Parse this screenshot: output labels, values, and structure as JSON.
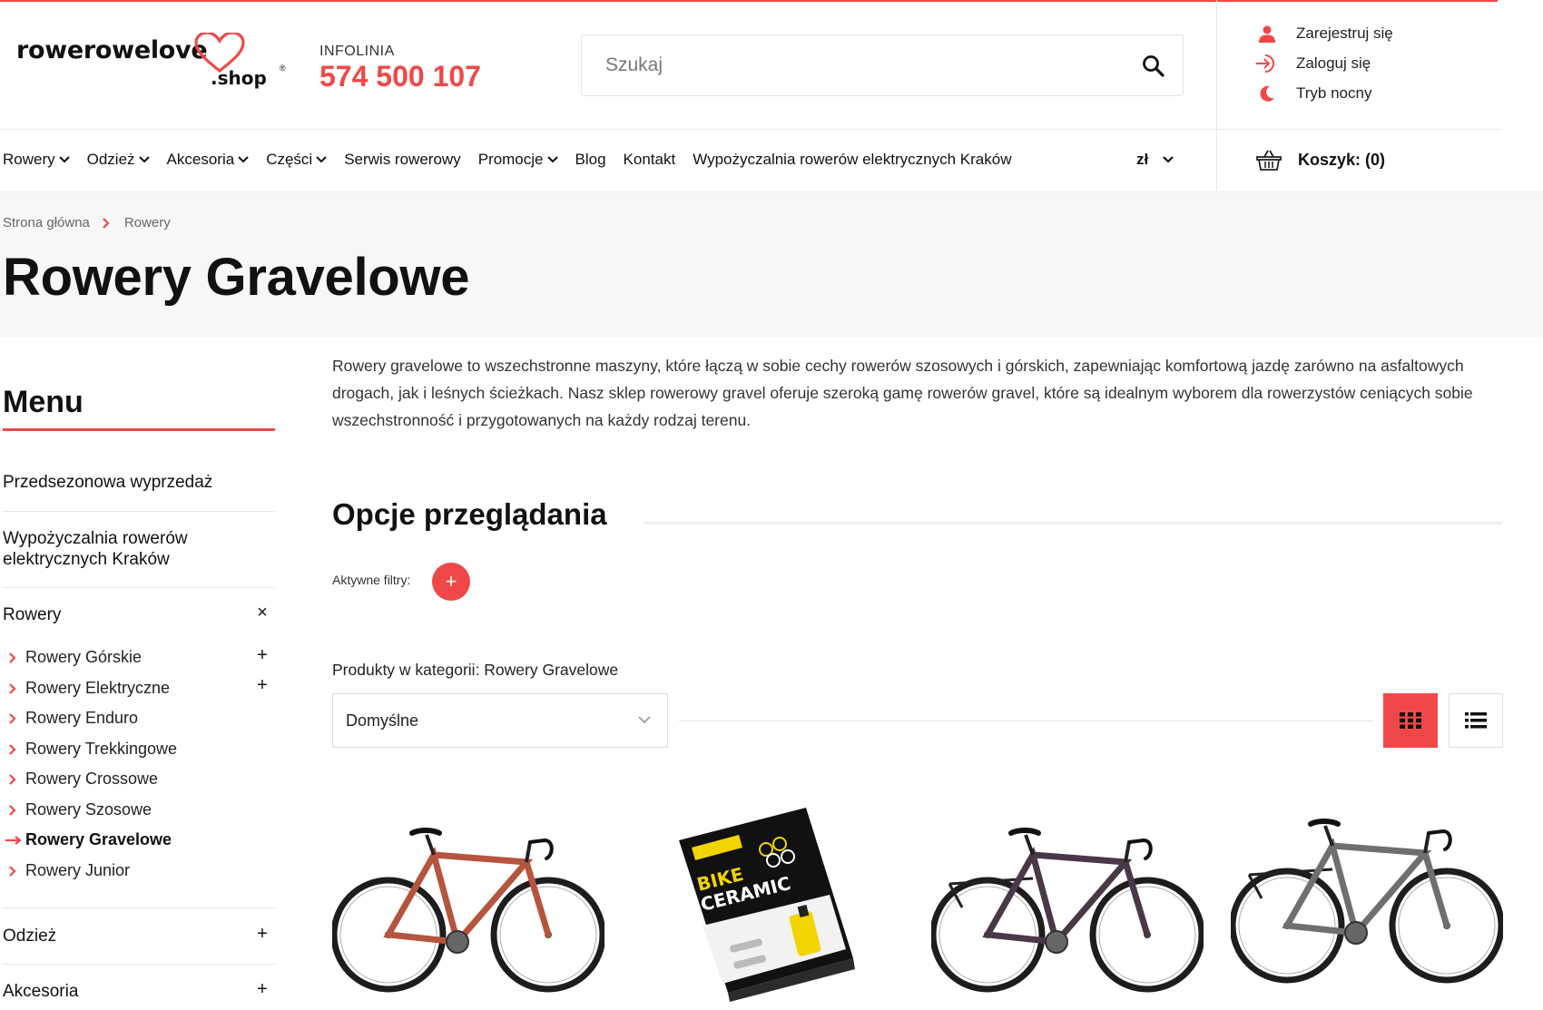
{
  "header": {
    "logo_text": "rowerowelove",
    "logo_suffix": ".shop",
    "logo_reg": "®",
    "infolinia_label": "INFOLINIA",
    "infolinia_phone": "574 500 107",
    "search_placeholder": "Szukaj",
    "account": {
      "register": "Zarejestruj się",
      "login": "Zaloguj się",
      "night_mode": "Tryb nocny"
    }
  },
  "nav": {
    "items": [
      {
        "label": "Rowery",
        "dropdown": true
      },
      {
        "label": "Odzież",
        "dropdown": true
      },
      {
        "label": "Akcesoria",
        "dropdown": true
      },
      {
        "label": "Części",
        "dropdown": true
      },
      {
        "label": "Serwis rowerowy",
        "dropdown": false
      },
      {
        "label": "Promocje",
        "dropdown": true
      },
      {
        "label": "Blog",
        "dropdown": false
      },
      {
        "label": "Kontakt",
        "dropdown": false
      },
      {
        "label": "Wypożyczalnia rowerów elektrycznych Kraków",
        "dropdown": false
      }
    ],
    "currency": "zł",
    "cart_label": "Koszyk: (0)"
  },
  "breadcrumb": [
    "Strona główna",
    "Rowery"
  ],
  "page_title": "Rowery Gravelowe",
  "sidebar": {
    "title": "Menu",
    "items": [
      {
        "label": "Przedsezonowa wyprzedaż"
      },
      {
        "label": "Wypożyczalnia rowerów elektrycznych Kraków"
      },
      {
        "label": "Rowery",
        "toggle": "×"
      },
      {
        "label": "Odzież",
        "toggle": "+"
      },
      {
        "label": "Akcesoria",
        "toggle": "+"
      }
    ],
    "subitems": [
      {
        "label": "Rowery Górskie",
        "toggle": "+"
      },
      {
        "label": "Rowery Elektryczne",
        "toggle": "+"
      },
      {
        "label": "Rowery Enduro"
      },
      {
        "label": "Rowery Trekkingowe"
      },
      {
        "label": "Rowery Crossowe"
      },
      {
        "label": "Rowery Szosowe"
      },
      {
        "label": "Rowery Gravelowe",
        "active": true
      },
      {
        "label": "Rowery Junior"
      }
    ]
  },
  "content": {
    "description": "Rowery gravelowe to wszechstronne maszyny, które łączą w sobie cechy rowerów szosowych i górskich, zapewniając komfortową jazdę zarówno na asfaltowych drogach, jak i leśnych ścieżkach. Nasz sklep rowerowy gravel oferuje szeroką gamę rowerów gravel, które są idealnym wyborem dla rowerzystów ceniących sobie wszechstronność i przygotowanych na każdy rodzaj terenu.",
    "browse_title": "Opcje przeglądania",
    "active_filters_label": "Aktywne filtry:",
    "add_filter_symbol": "+",
    "products_label": "Produkty w kategorii: Rowery Gravelowe",
    "sort_selected": "Domyślne",
    "view_active": "grid"
  },
  "products": [
    {
      "image": "gravel-bike-copper",
      "color": "#b5553e"
    },
    {
      "image": "bike-ceramic-kit-box",
      "box_brand": "BIKE",
      "box_title": "CERAMIC"
    },
    {
      "image": "gravel-bike-plum",
      "color": "#4a3848"
    },
    {
      "image": "gravel-bike-grey",
      "color": "#6f6f72"
    }
  ],
  "colors": {
    "accent": "#f04848",
    "text": "#111111",
    "band": "#f7f7f7"
  }
}
